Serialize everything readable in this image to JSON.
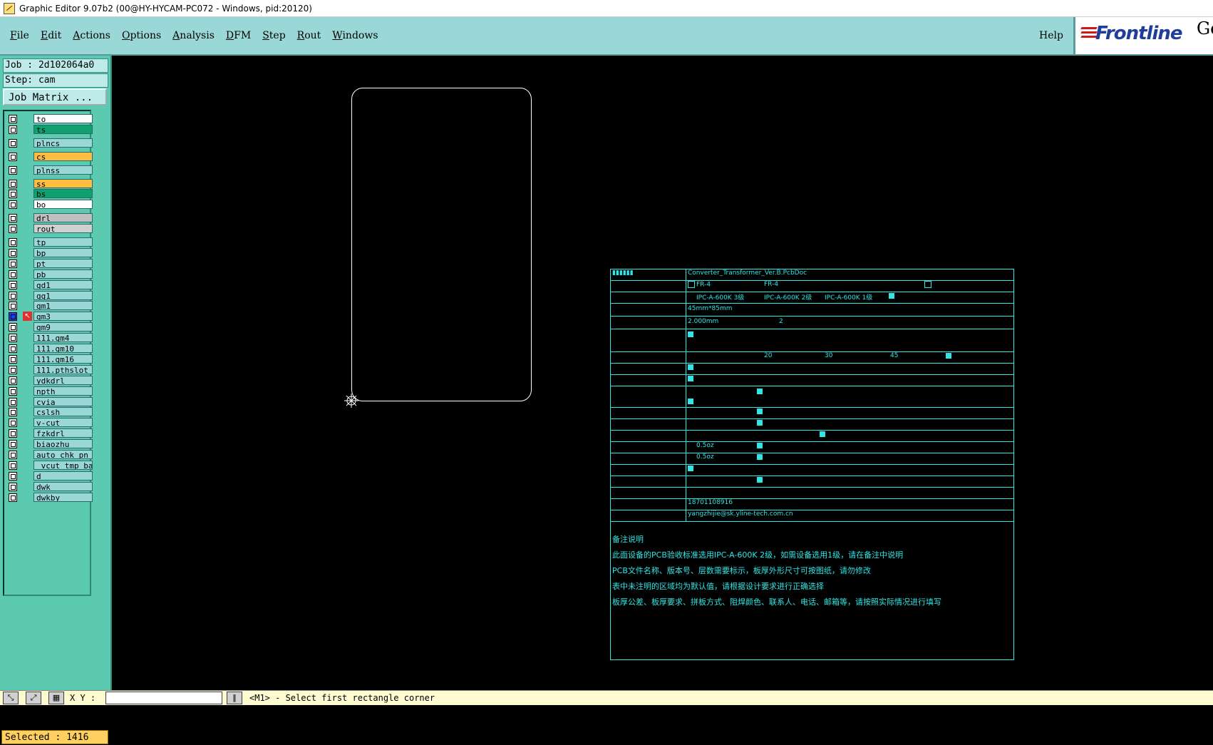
{
  "window": {
    "title": "Graphic Editor 9.07b2 (00@HY-HYCAM-PC072 - Windows, pid:20120)"
  },
  "menu": {
    "items": [
      "File",
      "Edit",
      "Actions",
      "Options",
      "Analysis",
      "DFM",
      "Step",
      "Rout",
      "Windows"
    ],
    "help": "Help"
  },
  "logo": {
    "text": "Frontline",
    "suffix": "Ge"
  },
  "job": {
    "job_label": "Job : 2d102064a0",
    "step_label": "Step: cam",
    "matrix_button": "Job Matrix ..."
  },
  "layers": [
    {
      "name": "to",
      "color": "#ffffff"
    },
    {
      "name": "ts",
      "color": "#10a070"
    },
    {
      "name": "plncs",
      "color": "#9ad8d8"
    },
    {
      "name": "cs",
      "color": "#ffbe40"
    },
    {
      "name": "plnss",
      "color": "#9ad8d8"
    },
    {
      "name": "ss",
      "color": "#ffbe40"
    },
    {
      "name": "bs",
      "color": "#10a070"
    },
    {
      "name": "bo",
      "color": "#ffffff"
    },
    {
      "name": "drl",
      "color": "#c0c0c0"
    },
    {
      "name": "rout",
      "color": "#d0d0d0"
    },
    {
      "name": "tp",
      "color": "#9ad8d8"
    },
    {
      "name": "bp",
      "color": "#9ad8d8"
    },
    {
      "name": "pt",
      "color": "#9ad8d8"
    },
    {
      "name": "pb",
      "color": "#9ad8d8"
    },
    {
      "name": "gd1",
      "color": "#9ad8d8"
    },
    {
      "name": "gg1",
      "color": "#9ad8d8"
    },
    {
      "name": "gm1",
      "color": "#9ad8d8"
    },
    {
      "name": "gm3",
      "color": "#9ad8d8",
      "active": true
    },
    {
      "name": "gm9",
      "color": "#9ad8d8"
    },
    {
      "name": "111.gm4",
      "color": "#9ad8d8"
    },
    {
      "name": "111.gm10",
      "color": "#9ad8d8"
    },
    {
      "name": "111.gm16",
      "color": "#9ad8d8"
    },
    {
      "name": "111.pthslot",
      "color": "#9ad8d8"
    },
    {
      "name": "ydkdrl",
      "color": "#9ad8d8"
    },
    {
      "name": "npth",
      "color": "#9ad8d8"
    },
    {
      "name": "cvia",
      "color": "#9ad8d8"
    },
    {
      "name": "cslsh",
      "color": "#9ad8d8"
    },
    {
      "name": "v-cut",
      "color": "#9ad8d8"
    },
    {
      "name": "fzkdrl",
      "color": "#9ad8d8"
    },
    {
      "name": "biaozhu",
      "color": "#9ad8d8"
    },
    {
      "name": "auto_chk_pn",
      "color": "#9ad8d8"
    },
    {
      "name": "_vcut_tmp_ba",
      "color": "#9ad8d8"
    },
    {
      "name": "d",
      "color": "#9ad8d8"
    },
    {
      "name": "dwk",
      "color": "#9ad8d8"
    },
    {
      "name": "dwkby",
      "color": "#9ad8d8"
    }
  ],
  "selected": "Selected : 1416",
  "spec": {
    "filename": "Converter_Transformer_Ver.B.PcbDoc",
    "board_size": "45mm*85mm",
    "thickness": "2.000mm",
    "quantity": "2",
    "val_20": "20",
    "val_30": "30",
    "val_45": "45",
    "copper_1": "0.5oz",
    "copper_2": "0.5oz",
    "phone": "18701108916",
    "email": "yangzhijie@sk.yline-tech.com.cn",
    "mat_opt": "FR-4",
    "tg_opt": "FR-4",
    "die_opt_1": "IPC-A-600K 3级",
    "die_opt_2": "IPC-A-600K 2级",
    "die_opt_3": "IPC-A-600K 1级",
    "notes_title": "备注说明",
    "notes": [
      "此面设备的PCB验收标准选用IPC-A-600K 2级，如需设备选用1级，请在备注中说明",
      "PCB文件名称、版本号、层数需要标示，板厚外形尺寸可按图纸，请勿修改",
      "表中未注明的区域均为默认值，请根据设计要求进行正确选择",
      "板厚公差、板厚要求、拼板方式、阻焊颜色、联系人、电话、邮箱等，请按照实际情况进行填写"
    ]
  },
  "status": {
    "xy_label": "X Y :",
    "prompt": "<M1> - Select first rectangle corner"
  }
}
